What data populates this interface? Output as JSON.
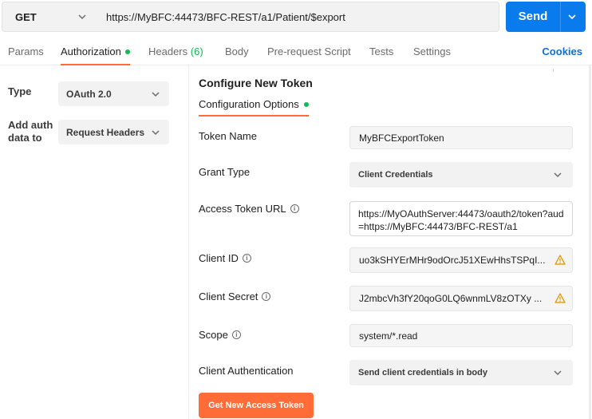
{
  "request": {
    "method": "GET",
    "url": "https://MyBFC:44473/BFC-REST/a1/Patient/$export",
    "send_label": "Send"
  },
  "tabs": [
    {
      "label": "Params"
    },
    {
      "label": "Authorization",
      "active": true,
      "indicator": "green-dot"
    },
    {
      "label": "Headers",
      "count": "(6)"
    },
    {
      "label": "Body"
    },
    {
      "label": "Pre-request Script"
    },
    {
      "label": "Tests"
    },
    {
      "label": "Settings"
    }
  ],
  "cookies_label": "Cookies",
  "auth": {
    "type_label": "Type",
    "type_value": "OAuth 2.0",
    "add_to_label_line1": "Add auth",
    "add_to_label_line2": "data to",
    "add_to_value": "Request Headers"
  },
  "token": {
    "title": "Configure New Token",
    "subtab": "Configuration Options",
    "fields": {
      "token_name": {
        "label": "Token Name",
        "value": "MyBFCExportToken"
      },
      "grant_type": {
        "label": "Grant Type",
        "value": "Client Credentials"
      },
      "access_token_url": {
        "label": "Access Token URL",
        "value": "https://MyOAuthServer:44473/oauth2/token?aud=https://MyBFC:44473/BFC-REST/a1"
      },
      "client_id": {
        "label": "Client ID",
        "value": "uo3kSHYErMHr9odOrcJ51XEwHhsTSPqI..."
      },
      "client_secret": {
        "label": "Client Secret",
        "value": "J2mbcVh3fY20qoG0LQ6wnmLV8zOTXy ..."
      },
      "scope": {
        "label": "Scope",
        "value": "system/*.read"
      },
      "client_auth": {
        "label": "Client Authentication",
        "value": "Send client credentials in body"
      }
    },
    "get_token_label": "Get New Access Token"
  },
  "colors": {
    "accent_orange": "#ff6c37",
    "send_blue": "#097bed",
    "status_green": "#0cbb52",
    "warning_amber": "#e6a117",
    "link_blue": "#0b6fd6"
  },
  "icons": [
    "chevron-down-icon",
    "info-icon",
    "warning-icon"
  ]
}
